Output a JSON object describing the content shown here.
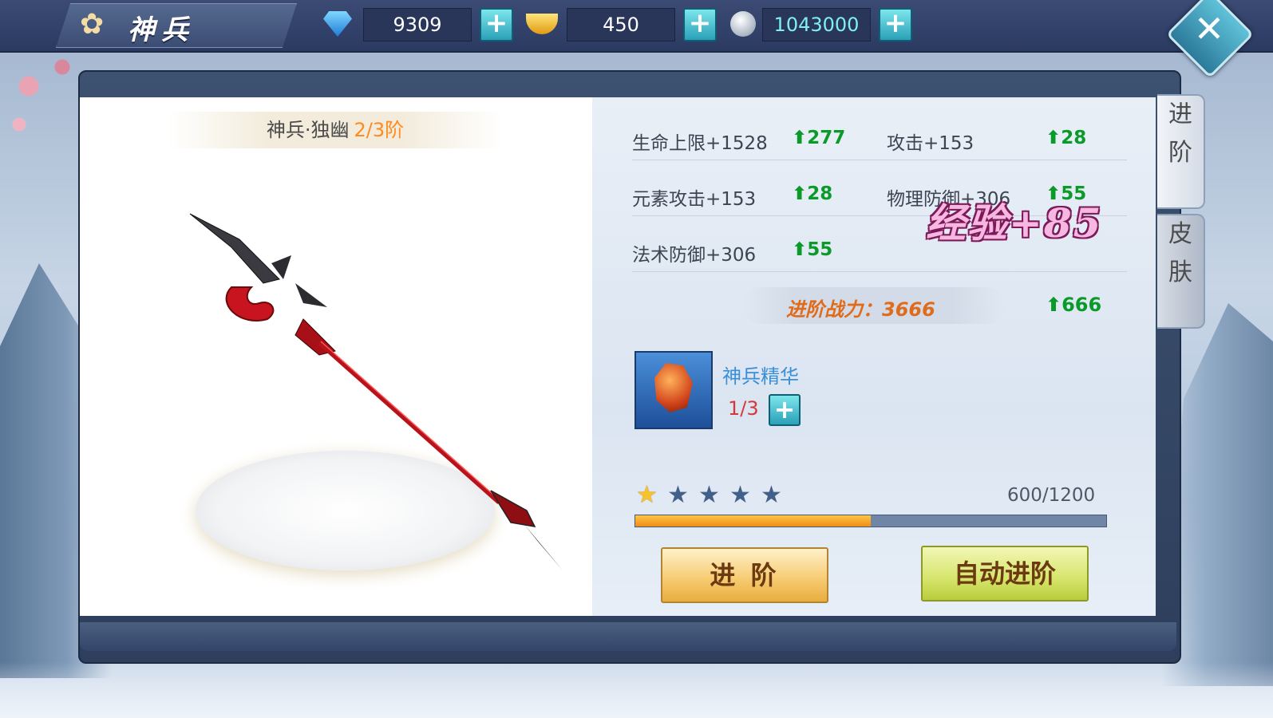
{
  "header": {
    "title": "神兵",
    "currencies": [
      {
        "icon": "diamond-icon",
        "value": "9309"
      },
      {
        "icon": "gold-ingot-icon",
        "value": "450"
      },
      {
        "icon": "silver-coin-icon",
        "value": "1043000"
      }
    ],
    "plus_label": "+",
    "close_label": "✕"
  },
  "weapon": {
    "name": "神兵·独幽",
    "rank": "2/3阶"
  },
  "stats": [
    {
      "label": "生命上限+1528",
      "gain": "277"
    },
    {
      "label": "攻击+153",
      "gain": "28"
    },
    {
      "label": "元素攻击+153",
      "gain": "28"
    },
    {
      "label": "物理防御+306",
      "gain": "55"
    },
    {
      "label": "法术防御+306",
      "gain": "55"
    }
  ],
  "power": {
    "label": "进阶战力：3666",
    "gain": "666"
  },
  "material": {
    "name": "神兵精华",
    "count": "1/3"
  },
  "progress": {
    "stars_total": 5,
    "stars_lit": 1,
    "exp_text": "600/1200",
    "exp_fraction": 0.5
  },
  "buttons": {
    "advance": "进 阶",
    "auto_advance": "自动进阶"
  },
  "side_tabs": [
    {
      "chars": [
        "进",
        "阶"
      ]
    },
    {
      "chars": [
        "皮",
        "肤"
      ]
    }
  ],
  "float_text": "经验+85",
  "colors": {
    "gain_green": "#0a9a2a",
    "rank_orange": "#ff8a1e",
    "material_blue": "#3a8fd6"
  }
}
